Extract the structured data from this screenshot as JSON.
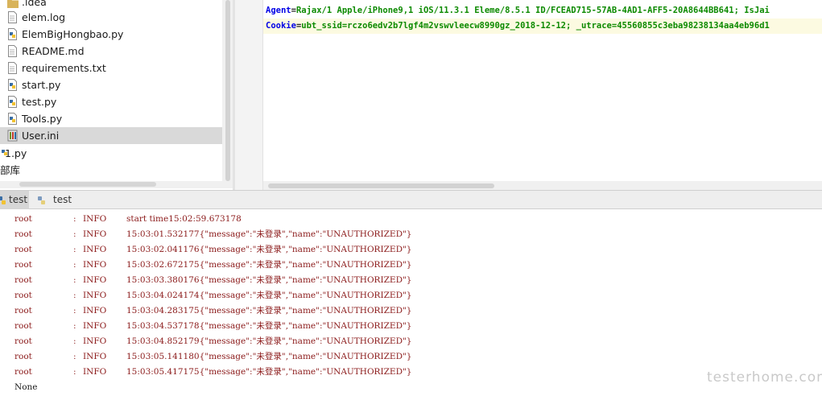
{
  "project_tree": {
    "items": [
      {
        "label": ".idea",
        "icon": "folder-icon"
      },
      {
        "label": "elem.log",
        "icon": "file-icon"
      },
      {
        "label": "ElemBigHongbao.py",
        "icon": "python-file-icon"
      },
      {
        "label": "README.md",
        "icon": "file-icon"
      },
      {
        "label": "requirements.txt",
        "icon": "file-icon"
      },
      {
        "label": "start.py",
        "icon": "python-file-icon"
      },
      {
        "label": "test.py",
        "icon": "python-file-icon"
      },
      {
        "label": "Tools.py",
        "icon": "python-file-icon"
      },
      {
        "label": "User.ini",
        "icon": "ini-file-icon",
        "selected": true
      },
      {
        "label": "1.py",
        "icon": "python-file-icon"
      },
      {
        "label": "部库",
        "icon": ""
      }
    ]
  },
  "editor": {
    "lines": [
      {
        "key": "Agent",
        "eq": "=",
        "value": "Rajax/1 Apple/iPhone9,1 iOS/11.3.1 Eleme/8.5.1 ID/FCEAD715-57AB-4AD1-AFF5-20A8644BB641; IsJai"
      },
      {
        "key": "Cookie",
        "eq": "=",
        "value": "ubt_ssid=rczo6edv2b7lgf4m2vswvleecw8990gz_2018-12-12; _utrace=45560855c3eba98238134aa4eb96d1"
      }
    ]
  },
  "run_tabs": [
    {
      "label": "test",
      "active": true,
      "icon": "python-run-icon"
    },
    {
      "label": "test",
      "active": false,
      "icon": "python-run-icon"
    }
  ],
  "console": {
    "lines": [
      {
        "name": "root",
        "sep": ":",
        "level": "INFO",
        "msg": "start time15:02:59.673178"
      },
      {
        "name": "root",
        "sep": ":",
        "level": "INFO",
        "msg": "15:03:01.532177{\"message\":\"未登录\",\"name\":\"UNAUTHORIZED\"}"
      },
      {
        "name": "root",
        "sep": ":",
        "level": "INFO",
        "msg": "15:03:02.041176{\"message\":\"未登录\",\"name\":\"UNAUTHORIZED\"}"
      },
      {
        "name": "root",
        "sep": ":",
        "level": "INFO",
        "msg": "15:03:02.672175{\"message\":\"未登录\",\"name\":\"UNAUTHORIZED\"}"
      },
      {
        "name": "root",
        "sep": ":",
        "level": "INFO",
        "msg": "15:03:03.380176{\"message\":\"未登录\",\"name\":\"UNAUTHORIZED\"}"
      },
      {
        "name": "root",
        "sep": ":",
        "level": "INFO",
        "msg": "15:03:04.024174{\"message\":\"未登录\",\"name\":\"UNAUTHORIZED\"}"
      },
      {
        "name": "root",
        "sep": ":",
        "level": "INFO",
        "msg": "15:03:04.283175{\"message\":\"未登录\",\"name\":\"UNAUTHORIZED\"}"
      },
      {
        "name": "root",
        "sep": ":",
        "level": "INFO",
        "msg": "15:03:04.537178{\"message\":\"未登录\",\"name\":\"UNAUTHORIZED\"}"
      },
      {
        "name": "root",
        "sep": ":",
        "level": "INFO",
        "msg": "15:03:04.852179{\"message\":\"未登录\",\"name\":\"UNAUTHORIZED\"}"
      },
      {
        "name": "root",
        "sep": ":",
        "level": "INFO",
        "msg": "15:03:05.141180{\"message\":\"未登录\",\"name\":\"UNAUTHORIZED\"}"
      },
      {
        "name": "root",
        "sep": ":",
        "level": "INFO",
        "msg": "15:03:05.417175{\"message\":\"未登录\",\"name\":\"UNAUTHORIZED\"}"
      }
    ],
    "final": "None"
  },
  "watermark": "testerhome.com",
  "colors": {
    "log_text": "#8b1a1a",
    "editor_key": "#0000e6",
    "editor_value": "#0c8a00",
    "selection": "#d9d9d9"
  }
}
